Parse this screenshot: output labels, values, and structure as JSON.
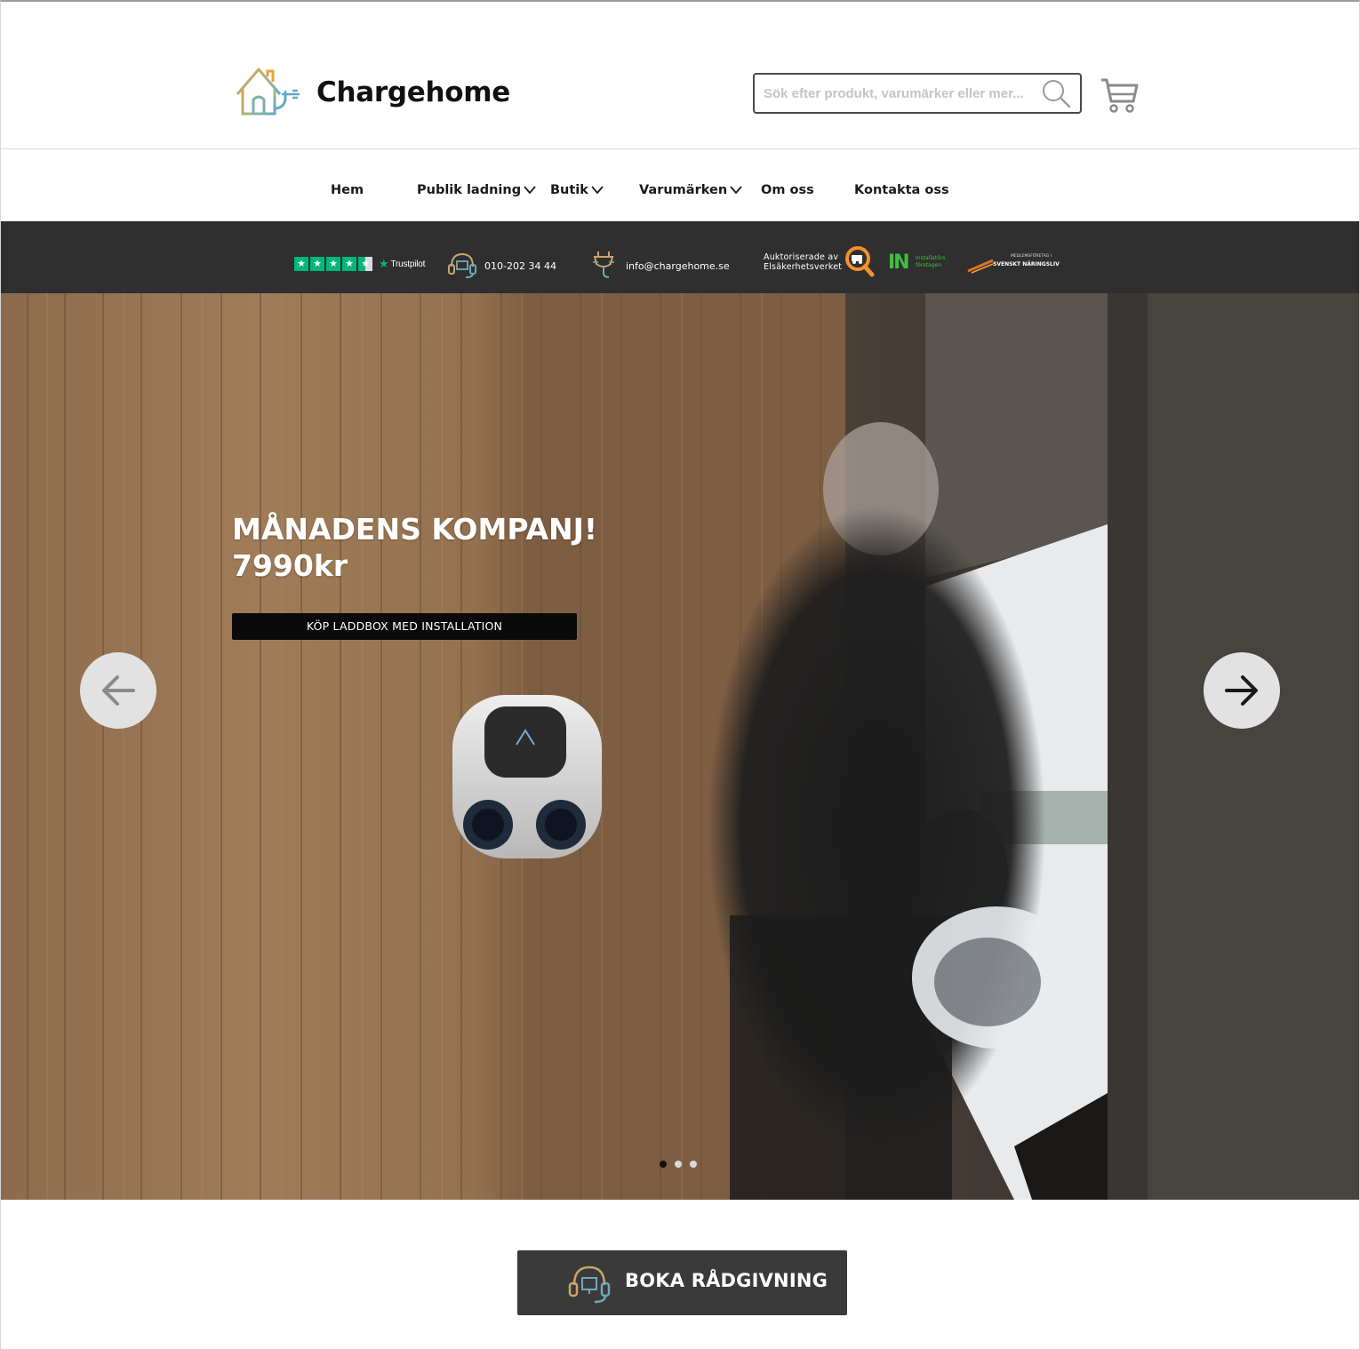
{
  "brand": {
    "name": "Chargehome",
    "logo_icon": "house-plug-icon"
  },
  "search": {
    "placeholder": "Sök efter produkt, varumärker eller mer...",
    "value": ""
  },
  "nav": {
    "items": [
      {
        "label": "Hem",
        "has_dropdown": false
      },
      {
        "label": "Publik ladning",
        "has_dropdown": true
      },
      {
        "label": "Butik",
        "has_dropdown": true
      },
      {
        "label": "Varumärken",
        "has_dropdown": true
      },
      {
        "label": "Om oss",
        "has_dropdown": false
      },
      {
        "label": "Kontakta oss",
        "has_dropdown": false
      }
    ]
  },
  "infobar": {
    "trustpilot": {
      "label": "Trustpilot",
      "stars": 4.5
    },
    "phone": "010-202 34 44",
    "email": "info@chargehome.se",
    "authorized": {
      "line1": "Auktoriserade av",
      "line2": "Elsäkerhetsverket"
    },
    "in_logo": {
      "mark": "IN",
      "line1": "Installatörs",
      "line2": "företagen"
    },
    "svenskt": {
      "small": "MEDLEMSFÖRETAG I",
      "big": "SVENSKT NÄRINGSLIV"
    }
  },
  "hero": {
    "title_line1": "MÅNADENS KOMPANJ!",
    "title_line2": "7990kr",
    "button_label": "KÖP LADDBOX MED INSTALLATION",
    "slides_total": 3,
    "active_slide": 1
  },
  "cta": {
    "label": "BOKA RÅDGIVNING"
  },
  "colors": {
    "infobar_bg": "#2f2f2f",
    "trustpilot_green": "#00b67a",
    "cta_bg": "#3a3a3a",
    "logo_orange": "#e8a23a",
    "logo_blue": "#5fa9c9"
  }
}
